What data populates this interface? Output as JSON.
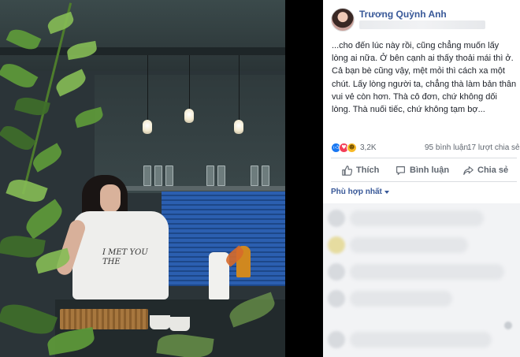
{
  "post": {
    "author": "Trương Quỳnh Anh",
    "text": "...cho đến lúc này rồi, cũng chẳng muốn lấy lòng ai nữa. Ở bên cạnh ai thấy thoải mái thì ở. Cả bạn bè cũng vậy, mệt mỏi thì cách xa một chút. Lấy lòng người ta, chẳng thà làm bản thân vui vẻ còn hơn. Thà cô đơn, chứ không dối lòng. Thà nuối tiếc, chứ không tạm bợ...",
    "shirt_print": "I MET YOU THE"
  },
  "stats": {
    "reactions": "3,2K",
    "comments": "95 bình luận",
    "shares": "17 lượt chia sẻ",
    "reaction_icons": [
      "like-icon",
      "love-icon",
      "haha-icon"
    ]
  },
  "actions": {
    "like": "Thích",
    "comment": "Bình luận",
    "share": "Chia sẻ"
  },
  "comments_sort": {
    "label": "Phù hợp nhất"
  },
  "colors": {
    "link_blue": "#385898",
    "like_blue": "#1877f2",
    "love_red": "#f33e58",
    "haha_yellow": "#f7b928",
    "text": "#1d2129",
    "muted": "#606770"
  }
}
